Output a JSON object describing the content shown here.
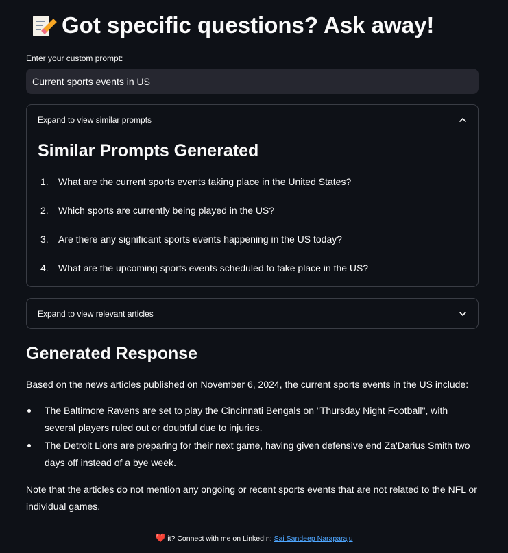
{
  "header": {
    "icon": "memo-icon",
    "title": "Got specific questions? Ask away!"
  },
  "prompt": {
    "label": "Enter your custom prompt:",
    "value": "Current sports events in US"
  },
  "similar_expander": {
    "label": "Expand to view similar prompts",
    "state": "expanded",
    "title": "Similar Prompts Generated",
    "items": [
      {
        "num": "1.",
        "text": "What are the current sports events taking place in the United States?"
      },
      {
        "num": "2.",
        "text": "Which sports are currently being played in the US?"
      },
      {
        "num": "3.",
        "text": "Are there any significant sports events happening in the US today?"
      },
      {
        "num": "4.",
        "text": "What are the upcoming sports events scheduled to take place in the US?"
      }
    ]
  },
  "articles_expander": {
    "label": "Expand to view relevant articles",
    "state": "collapsed"
  },
  "response": {
    "title": "Generated Response",
    "intro": "Based on the news articles published on November 6, 2024, the current sports events in the US include:",
    "bullets": [
      "The Baltimore Ravens are set to play the Cincinnati Bengals on \"Thursday Night Football\", with several players ruled out or doubtful due to injuries.",
      "The Detroit Lions are preparing for their next game, having given defensive end Za'Darius Smith two days off instead of a bye week."
    ],
    "note": "Note that the articles do not mention any ongoing or recent sports events that are not related to the NFL or individual games."
  },
  "footer": {
    "heart": "❤️",
    "text": " it? Connect with me on LinkedIn: ",
    "link_text": "Sai Sandeep Naraparaju"
  },
  "colors": {
    "background": "#0e1117",
    "input_bg": "#262730",
    "border": "#3a3d45",
    "link": "#4ea6ff",
    "heart": "#ff3b4b"
  }
}
